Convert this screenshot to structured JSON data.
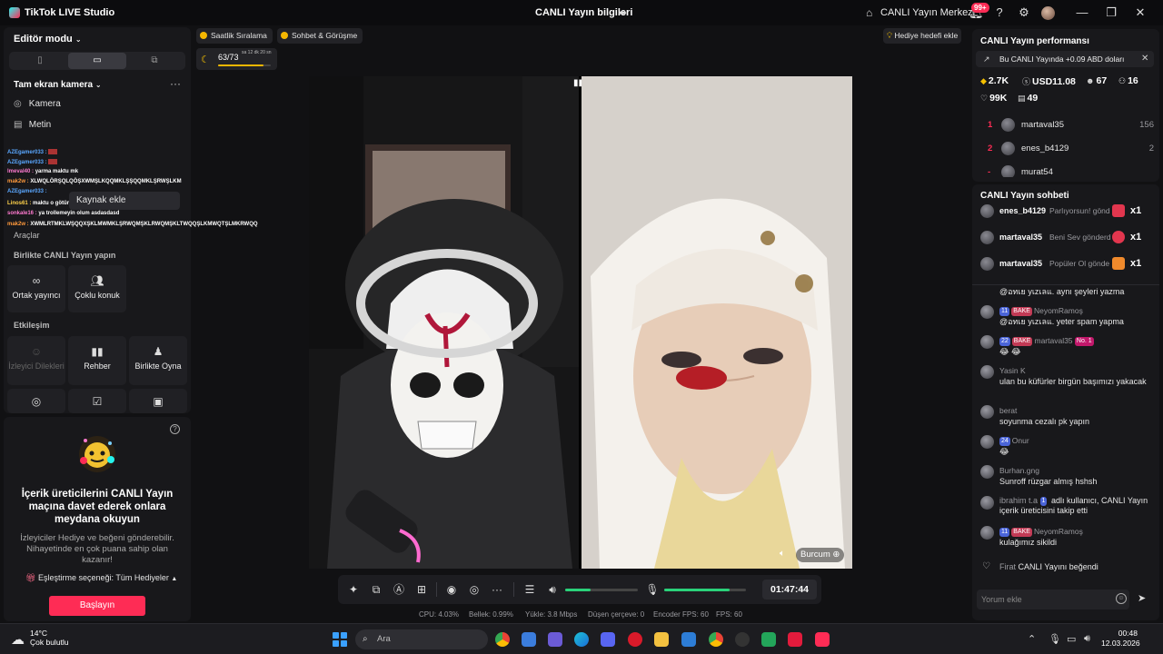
{
  "titlebar": {
    "app_name": "TikTok LIVE Studio",
    "center_title": "CANLI Yayın bilgileri",
    "live_center": "CANLI Yayın Merkezi",
    "notifications_badge": "99+"
  },
  "left": {
    "editor_mode": "Editör modu",
    "scene_title": "Tam ekran kamera",
    "sources": [
      {
        "label": "Kamera",
        "icon": "camera-icon"
      },
      {
        "label": "Metin",
        "icon": "text-icon"
      }
    ],
    "overlay_lines": [
      {
        "user": "AZEgamer033 :",
        "text": ""
      },
      {
        "user": "AZEgamer033 :",
        "text": ""
      },
      {
        "user": "lmeval40 :",
        "text": "yarma maktu mk"
      },
      {
        "user": "mak2w :",
        "text": "XLWQLÖRŞQLQÖŞXWMŞLKQQMKLŞŞQQMKLŞRWŞLKM"
      },
      {
        "user": "AZEgamer033 :",
        "text": ""
      },
      {
        "user": "Linos61 :",
        "text": "maktu o götüne girrm"
      },
      {
        "user": "sonkale16 :",
        "text": "ya trollemeyin olum asdasdasd"
      },
      {
        "user": "mak2w :",
        "text": "XWMLRTMKLWŞQQXŞKLMWMKLŞRWQMŞKLRWQMŞKLTWQQŞLKMWQTŞLMKRWQQ"
      }
    ],
    "add_source": "Kaynak ekle",
    "tools_label": "Araçlar",
    "collab_label": "Birlikte CANLI Yayın yapın",
    "collab_tiles": [
      {
        "label": "Ortak yayıncı",
        "icon": "link-icon"
      },
      {
        "label": "Çoklu konuk",
        "icon": "multi-guest-icon"
      }
    ],
    "interaction_label": "Etkileşim",
    "interaction_tiles": [
      {
        "label": "İzleyici Dilekleri",
        "icon": "viewer-wishes-icon"
      },
      {
        "label": "Rehber",
        "icon": "guide-icon"
      },
      {
        "label": "Birlikte Oyna",
        "icon": "play-together-icon"
      }
    ]
  },
  "promo": {
    "title": "İçerik üreticilerini CANLI Yayın maçına davet ederek onlara meydana okuyun",
    "description": "İzleyiciler Hediye ve beğeni gönderebilir. Nihayetinde en çok puana sahip olan kazanır!",
    "option": "Eşleştirme seçeneği: Tüm Hediyeler",
    "start_button": "Başlayın"
  },
  "center": {
    "pill_hourly": "Saatlik Sıralama",
    "pill_chat": "Sohbet & Görüşme",
    "gift_goal": "Hediye hedefi ekle",
    "goal_value": "63/73",
    "goal_time": "sa 12 dk 20 sn",
    "goal_progress": 0.86,
    "guest_name": "Burcum"
  },
  "controls": {
    "timer": "01:47:44",
    "volume_level": 0.35,
    "mic_level": 0.8
  },
  "stats": {
    "cpu": "CPU: 4.03%",
    "memory": "Bellek: 0.99%",
    "upload": "Yükle: 3.8 Mbps",
    "dropped": "Düşen çerçeve: 0",
    "encoder_fps": "Encoder FPS: 60",
    "fps": "FPS: 60"
  },
  "performance": {
    "title": "CANLI Yayın performansı",
    "banner": "Bu CANLI Yayında +0.09 ABD doları",
    "diamonds": "2.7K",
    "usd": "USD11.08",
    "viewers": "67",
    "new_followers": "16",
    "likes": "99K",
    "gifters": "49",
    "ranking": [
      {
        "rank": "1",
        "name": "martaval35",
        "score": "156"
      },
      {
        "rank": "2",
        "name": "enes_b4129",
        "score": "2"
      },
      {
        "rank": "-",
        "name": "murat54",
        "score": ""
      }
    ]
  },
  "chat": {
    "title": "CANLI Yayın sohbeti",
    "gifts": [
      {
        "user": "enes_b4129",
        "text": "Parlıyorsun! gönd",
        "count": "x1",
        "color": "#e2364e"
      },
      {
        "user": "martaval35",
        "text": "Beni Sev gönderdi",
        "count": "x1",
        "color": "#e2364e"
      },
      {
        "user": "martaval35",
        "text": "Popüler Ol gönde",
        "count": "x1",
        "color": "#f08a2c"
      }
    ],
    "partial_top": "@อทเย yเzเลแ.",
    "partial_top_text": "aynı şeyleri yazma",
    "messages": [
      {
        "lvl": "11",
        "fan": "BAKE",
        "user": "NeyomRamoş",
        "body": "@อทเย yเzเลแ.  yeter spam yapma"
      },
      {
        "lvl": "22",
        "fan": "BAKE",
        "user": "martaval35",
        "no1": "No. 1",
        "body": "😂 😂"
      },
      {
        "user": "Yasin K",
        "body": "ulan bu küfürler birgün başımızı yakacak"
      },
      {
        "user": "berat",
        "body": "soyunma cezalı pk yapın"
      },
      {
        "lvl": "24",
        "user": "Onur",
        "body": "😂"
      },
      {
        "user": "Burhan.gng",
        "body": "Sunroff rüzgar almış hshsh"
      }
    ],
    "follow_msg_user": "ibrahim t.a",
    "follow_msg_lvl": "1",
    "follow_msg": "adlı kullanıcı, CANLI Yayın içerik üreticisini takip etti",
    "last_msg": {
      "lvl": "11",
      "fan": "BAKE",
      "user": "NeyomRamoş",
      "body": "kulağımız sikildi"
    },
    "like_msg_user": "Firat",
    "like_msg": "CANLI Yayını beğendi",
    "input_placeholder": "Yorum ekle"
  },
  "taskbar": {
    "temp": "14°C",
    "weather": "Çok bulutlu",
    "search": "Ara",
    "time": "00:48",
    "date": "12.03.2026"
  }
}
